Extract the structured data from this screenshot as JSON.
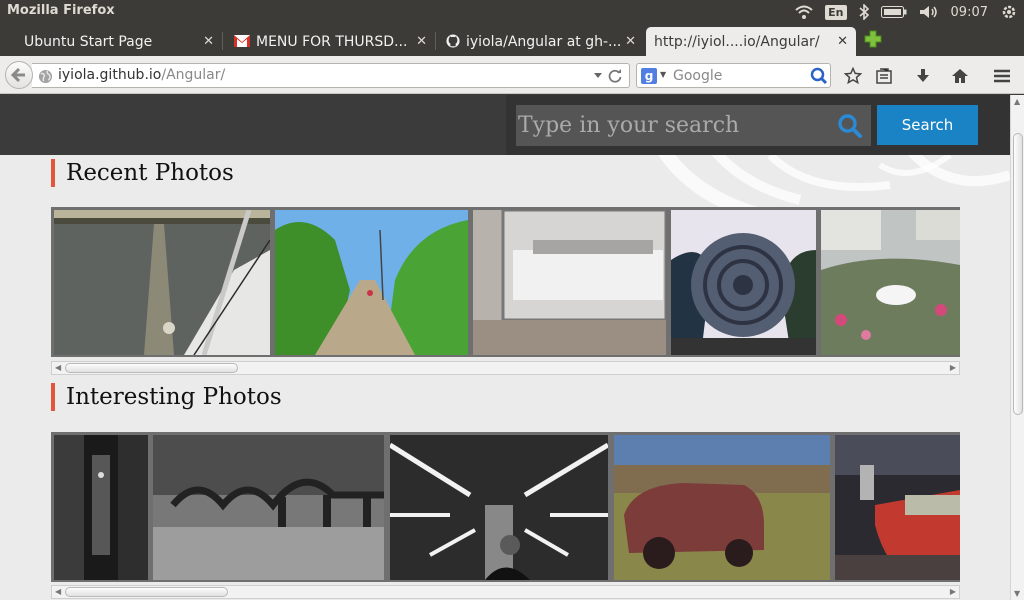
{
  "window": {
    "title": "Mozilla Firefox"
  },
  "tray": {
    "language": "En",
    "clock": "09:07"
  },
  "tabs": [
    {
      "label": "Ubuntu Start Page",
      "favicon": "none"
    },
    {
      "label": "MENU FOR THURSD...",
      "favicon": "gmail-icon"
    },
    {
      "label": "iyiola/Angular at gh-...",
      "favicon": "github-icon"
    },
    {
      "label": "http://iyiol....io/Angular/",
      "favicon": "none",
      "active": true
    }
  ],
  "navbar": {
    "url_host": "iyiola.github.io",
    "url_path": "/Angular/",
    "search_placeholder": "Google"
  },
  "page": {
    "search": {
      "placeholder": "Type in your search",
      "button_label": "Search"
    },
    "sections": [
      {
        "title": "Recent Photos"
      },
      {
        "title": "Interesting Photos"
      }
    ]
  },
  "colors": {
    "accent_bar": "#e2563b",
    "search_button": "#1a83c6",
    "header_bg": "#3b3b3b"
  }
}
